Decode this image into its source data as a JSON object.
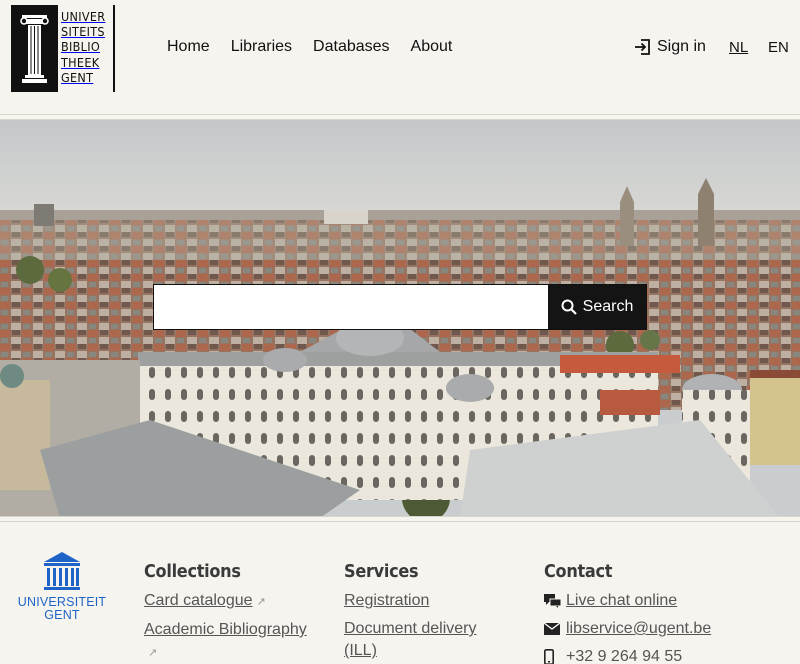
{
  "logo": {
    "lines": [
      "UNIVER",
      "SITEITS",
      "BIBLIO",
      "THEEK",
      "GENT"
    ]
  },
  "nav": {
    "items": [
      {
        "label": "Home"
      },
      {
        "label": "Libraries"
      },
      {
        "label": "Databases"
      },
      {
        "label": "About"
      }
    ]
  },
  "header": {
    "signin_label": "Sign in",
    "lang_nl": "NL",
    "lang_en": "EN"
  },
  "search": {
    "placeholder": "",
    "value": "",
    "button_label": "Search"
  },
  "footer": {
    "ugent_logo_text": [
      "UNIVERSITEIT",
      "GENT"
    ],
    "collections": {
      "title": "Collections",
      "links": [
        {
          "label": "Card catalogue"
        },
        {
          "label": "Academic Bibliography"
        }
      ]
    },
    "services": {
      "title": "Services",
      "links": [
        {
          "label": "Registration"
        },
        {
          "label": "Document delivery (ILL)"
        }
      ]
    },
    "contact": {
      "title": "Contact",
      "live_chat": "Live chat online",
      "email": "libservice@ugent.be",
      "phone": "+32 9 264 94 55"
    }
  },
  "colors": {
    "background": "#f6f4ef",
    "ugent_blue": "#1e64c8",
    "search_button": "#141414"
  }
}
